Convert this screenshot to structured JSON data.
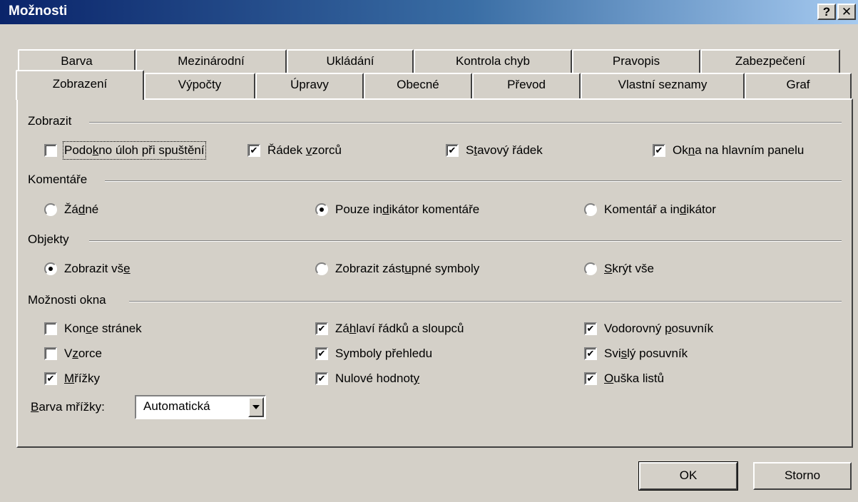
{
  "window": {
    "title": "Možnosti",
    "help_glyph": "?",
    "close_glyph": "✕"
  },
  "tabs_back": [
    "Barva",
    "Mezinárodní",
    "Ukládání",
    "Kontrola chyb",
    "Pravopis",
    "Zabezpečení"
  ],
  "tabs_front": [
    "Zobrazení",
    "Výpočty",
    "Úpravy",
    "Obecné",
    "Převod",
    "Vlastní seznamy",
    "Graf"
  ],
  "active_tab": "Zobrazení",
  "groups": {
    "show": "Zobrazit",
    "comments": "Komentáře",
    "objects": "Objekty",
    "window_options": "Možnosti okna"
  },
  "show_options": [
    {
      "pre": "Podo",
      "key": "k",
      "post": "no úloh při spuštění",
      "checked": false
    },
    {
      "pre": "Řádek ",
      "key": "v",
      "post": "zorců",
      "checked": true
    },
    {
      "pre": "S",
      "key": "t",
      "post": "avový řádek",
      "checked": true
    },
    {
      "pre": "Ok",
      "key": "n",
      "post": "a na hlavním panelu",
      "checked": true
    }
  ],
  "comment_options": [
    {
      "pre": "Žá",
      "key": "d",
      "post": "né",
      "selected": false
    },
    {
      "pre": "Pouze in",
      "key": "d",
      "post": "ikátor komentáře",
      "selected": true
    },
    {
      "pre": "Komentář a in",
      "key": "d",
      "post": "ikátor",
      "selected": false
    }
  ],
  "object_options": [
    {
      "pre": "Zobrazit vš",
      "key": "e",
      "post": "",
      "selected": true
    },
    {
      "pre": "Zobrazit zást",
      "key": "u",
      "post": "pné symboly",
      "selected": false
    },
    {
      "pre": "",
      "key": "S",
      "post": "krýt vše",
      "selected": false
    }
  ],
  "window_options": [
    {
      "pre": "Kon",
      "key": "c",
      "post": "e stránek",
      "checked": false
    },
    {
      "pre": "Zá",
      "key": "h",
      "post": "laví řádků a sloupců",
      "checked": true
    },
    {
      "pre": "Vodorovný ",
      "key": "p",
      "post": "osuvník",
      "checked": true
    },
    {
      "pre": "V",
      "key": "z",
      "post": "orce",
      "checked": false
    },
    {
      "pre": "Symboly přehledu",
      "key": "",
      "post": "",
      "checked": true
    },
    {
      "pre": "Svi",
      "key": "s",
      "post": "lý posuvník",
      "checked": true
    },
    {
      "pre": "",
      "key": "M",
      "post": "řížky",
      "checked": true
    },
    {
      "pre": "Nulové hodnot",
      "key": "y",
      "post": "",
      "checked": true
    },
    {
      "pre": "",
      "key": "O",
      "post": "uška listů",
      "checked": true
    }
  ],
  "grid_color": {
    "label_pre": "",
    "label_key": "B",
    "label_post": "arva mřížky:",
    "value": "Automatická"
  },
  "buttons": {
    "ok": "OK",
    "cancel": "Storno"
  },
  "check_glyph": "✔"
}
